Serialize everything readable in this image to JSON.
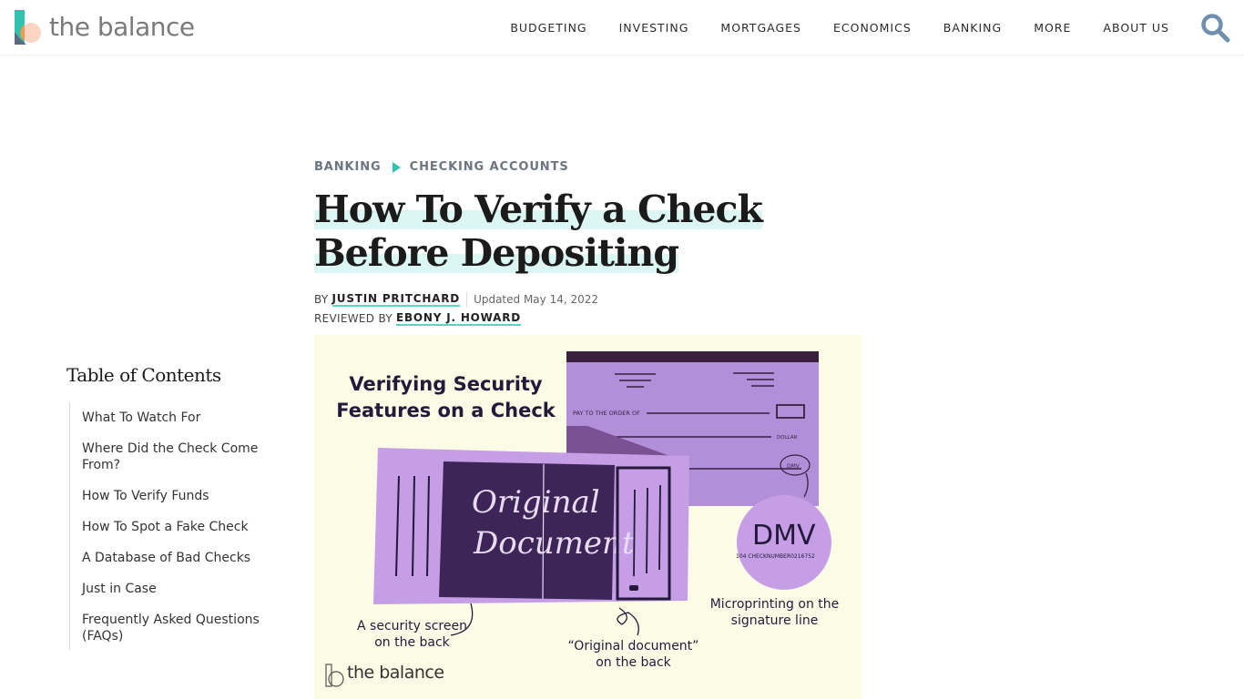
{
  "header": {
    "logo_text": "the balance",
    "nav": [
      "BUDGETING",
      "INVESTING",
      "MORTGAGES",
      "ECONOMICS",
      "BANKING",
      "MORE",
      "ABOUT US"
    ],
    "search_icon": "search-icon",
    "colors": {
      "search": "#6f8faf",
      "logo_teal": "#2fc3b0",
      "logo_orange": "#f79a4d",
      "logo_peach": "#fcd4c3",
      "logo_slate": "#5c6b82"
    }
  },
  "article": {
    "breadcrumb": [
      "BANKING",
      "CHECKING ACCOUNTS"
    ],
    "title": "How To Verify a Check Before Depositing",
    "byline": {
      "by_label": "BY",
      "author": "JUSTIN PRITCHARD",
      "updated": "Updated May 14, 2022",
      "reviewed_label": "REVIEWED BY",
      "reviewer": "EBONY J. HOWARD"
    }
  },
  "toc": {
    "title": "Table of Contents",
    "items": [
      "What To Watch For",
      "Where Did the Check Come From?",
      "How To Verify Funds",
      "How To Spot a Fake Check",
      "A Database of Bad Checks",
      "Just in Case",
      "Frequently Asked Questions (FAQs)"
    ]
  },
  "figure": {
    "heading": "Verifying Security Features on a Check",
    "check_front": {
      "pay_to": "PAY TO THE ORDER OF",
      "dollar": "DOLLAR",
      "signature_micro": "DMV"
    },
    "check_back": {
      "script_line1": "Original",
      "script_line2": "Document"
    },
    "zoom_circle": {
      "big": "DMV",
      "micro": "104 CHECKNUMBER0216752"
    },
    "captions": {
      "security_screen": "A security screen on the back",
      "original_document": "“Original document” on the back",
      "microprinting": "Microprinting on the signature line"
    },
    "watermark": "the balance"
  }
}
